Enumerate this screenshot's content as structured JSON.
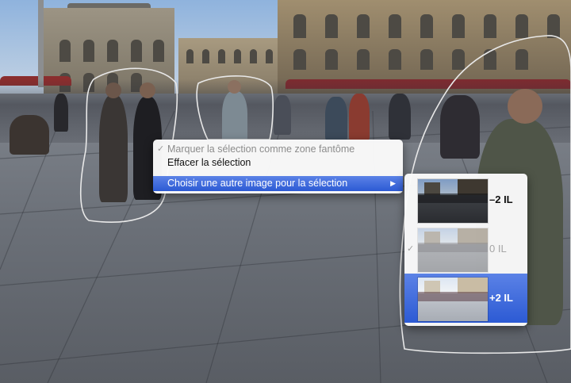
{
  "colors": {
    "menu_highlight": "#3a66dd",
    "menu_background": "#fafafa",
    "disabled_text": "#8c8c8c",
    "selection_outline": "#e8e8e8"
  },
  "icons": {
    "check": "check-icon",
    "submenu_arrow": "submenu-arrow-icon"
  },
  "context_menu": {
    "items": [
      {
        "label": "Marquer la sélection comme zone fantôme",
        "checked": true,
        "enabled": false
      },
      {
        "label": "Effacer la sélection",
        "checked": false,
        "enabled": true
      },
      {
        "label": "Choisir une autre image pour la sélection",
        "highlighted": true,
        "has_submenu": true
      }
    ]
  },
  "submenu": {
    "items": [
      {
        "label": "–2 IL",
        "state": "normal"
      },
      {
        "label": "0 IL",
        "state": "checked-disabled"
      },
      {
        "label": "+2 IL",
        "state": "highlighted"
      }
    ]
  }
}
